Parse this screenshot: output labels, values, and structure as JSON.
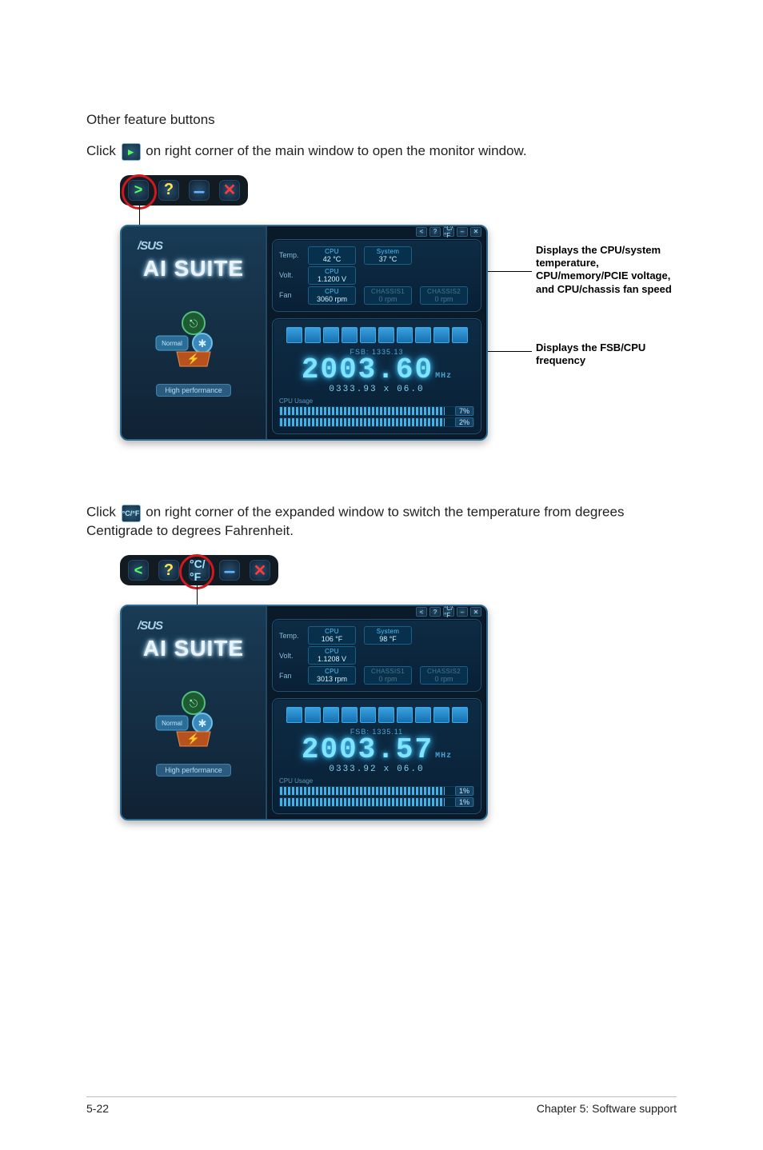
{
  "heading": "Other feature buttons",
  "para1_prefix": "Click ",
  "para1_suffix": " on right corner of the main window to open the monitor window.",
  "para2_prefix": "Click ",
  "para2_suffix": " on right corner of the expanded window to switch the temperature from degrees Centigrade to degrees Fahrenheit.",
  "annot_monitor": "Displays the CPU/system temperature, CPU/memory/PCIE voltage, and CPU/chassis fan speed",
  "annot_freq": "Displays the FSB/CPU frequency",
  "titlebar_c": {
    "expand": ">",
    "help": "?",
    "min": "–",
    "close": "✕"
  },
  "titlebar_f": {
    "back": "<",
    "help": "?",
    "cf": "°C/°F",
    "min": "–",
    "close": "✕"
  },
  "top_mini_c": [
    "<",
    "?",
    "°C/°F",
    "–",
    "✕"
  ],
  "top_mini_f": [
    "<",
    "?",
    "°C/°F",
    "–",
    "✕"
  ],
  "brand1": "/SUS",
  "brand2": "AI SUITE",
  "perf_label": "High performance",
  "monitor_c": {
    "rows": {
      "temp": {
        "tag": "Temp.",
        "cpu_lbl": "CPU",
        "cpu_val": "42 °C",
        "sys_lbl": "System",
        "sys_val": "37 °C"
      },
      "volt": {
        "tag": "Volt.",
        "cpu_lbl": "CPU",
        "cpu_val": "1.1200 V"
      },
      "fan": {
        "tag": "Fan",
        "cpu_lbl": "CPU",
        "cpu_val": "3060 rpm",
        "ch1_lbl": "CHASSIS1",
        "ch1_val": "0 rpm",
        "ch2_lbl": "CHASSIS2",
        "ch2_val": "0 rpm"
      }
    }
  },
  "monitor_f": {
    "rows": {
      "temp": {
        "tag": "Temp.",
        "cpu_lbl": "CPU",
        "cpu_val": "106 °F",
        "sys_lbl": "System",
        "sys_val": "98 °F"
      },
      "volt": {
        "tag": "Volt.",
        "cpu_lbl": "CPU",
        "cpu_val": "1.1208 V"
      },
      "fan": {
        "tag": "Fan",
        "cpu_lbl": "CPU",
        "cpu_val": "3013 rpm",
        "ch1_lbl": "CHASSIS1",
        "ch1_val": "0 rpm",
        "ch2_lbl": "CHASSIS2",
        "ch2_val": "0 rpm"
      }
    }
  },
  "freq_c": {
    "fsb_label": "FSB: 1335.13",
    "big": "2003.60",
    "unit": "MHz",
    "sub_a": "0333.93",
    "sub_x": "x",
    "sub_b": "06.0",
    "usage_lbl": "CPU Usage",
    "pct1": "7%",
    "pct2": "2%"
  },
  "freq_f": {
    "fsb_label": "FSB: 1335.11",
    "big": "2003.57",
    "unit": "MHz",
    "sub_a": "0333.92",
    "sub_x": "x",
    "sub_b": "06.0",
    "usage_lbl": "CPU Usage",
    "pct1": "1%",
    "pct2": "1%"
  },
  "footer_left": "5-22",
  "footer_right": "Chapter 5: Software support"
}
